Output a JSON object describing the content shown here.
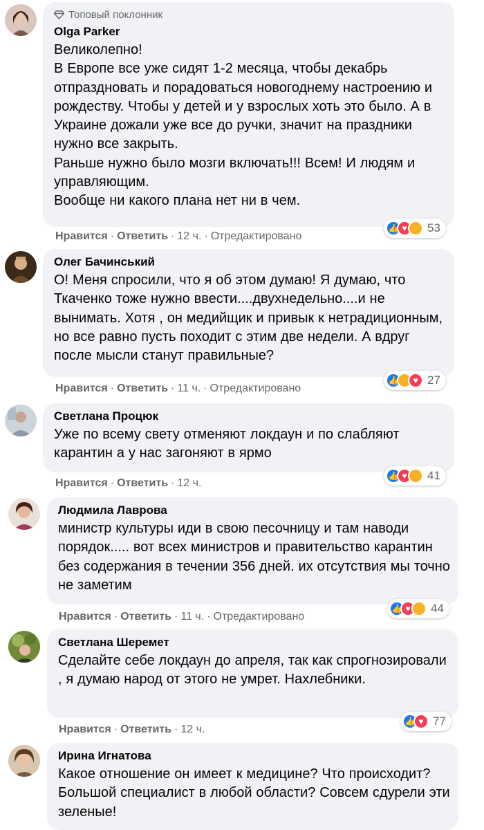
{
  "colors": {
    "bubble": "#f0f2f5",
    "meta": "#65676b",
    "like": "#1877f2",
    "love": "#f33e58",
    "emoji": "#f7b125"
  },
  "actions": {
    "like": "Нравится",
    "reply": "Ответить",
    "edited": "Отредактировано"
  },
  "comments": [
    {
      "badge": "Топовый поклонник",
      "author": "Olga Parker",
      "text": "Великолепно!\nВ Европе все уже сидят 1-2 месяца, чтобы декабрь отпраздновать и порадоваться новогоднему настроению и рождеству. Чтобы у детей и у взрослых хоть это было. А в Украине дожали уже все до ручки, значит на праздники нужно все закрыть.\nРаньше нужно было мозги включать!!! Всем! И людям и управляющим.\nВообще ни какого плана нет ни в чем.",
      "time": "12 ч.",
      "reaction_icons": [
        "like-icon",
        "love-icon",
        "haha-icon"
      ],
      "reaction_count": "53"
    },
    {
      "author": "Олег Бачинський",
      "text": "О! Меня спросили, что я об этом думаю! Я думаю, что Ткаченко тоже нужно ввести....двухнедельно....и не вынимать. Хотя , он медийщик и привык к нетрадиционным, но все равно пусть походит с этим две недели. А вдруг после мысли станут правильные?",
      "time": "11 ч.",
      "reaction_icons": [
        "like-icon",
        "haha-icon",
        "love-icon"
      ],
      "reaction_count": "27"
    },
    {
      "author": "Светлана Процюк",
      "text": "Уже по всему свету отменяют локдаун и по слабляют карантин а у нас загоняют в ярмо",
      "time": "12 ч.",
      "reaction_icons": [
        "like-icon",
        "love-icon",
        "sad-icon"
      ],
      "reaction_count": "41"
    },
    {
      "author": "Людмила Лаврова",
      "text": "министр культуры иди в свою песочницу и там наводи порядок..... вот всех министров и правительство карантин без содержания в течении 356 дней. их отсутствия мы точно не заметим",
      "time": "11 ч.",
      "reaction_icons": [
        "like-icon",
        "love-icon",
        "wow-icon"
      ],
      "reaction_count": "44"
    },
    {
      "author": "Светлана Шеремет",
      "text": "Сделайте себе локдаун до апреля, так как спрогнозировали , я думаю народ от этого не умрет. Нахлебники.",
      "time": "12 ч.",
      "reaction_icons": [
        "like-icon",
        "love-icon"
      ],
      "reaction_count": "77"
    },
    {
      "author": "Ирина Игнатова",
      "text": "Какое отношение он имеет к медицине? Что происходит? Большой специалист в любой области? Совсем сдурели эти зеленые!"
    }
  ]
}
